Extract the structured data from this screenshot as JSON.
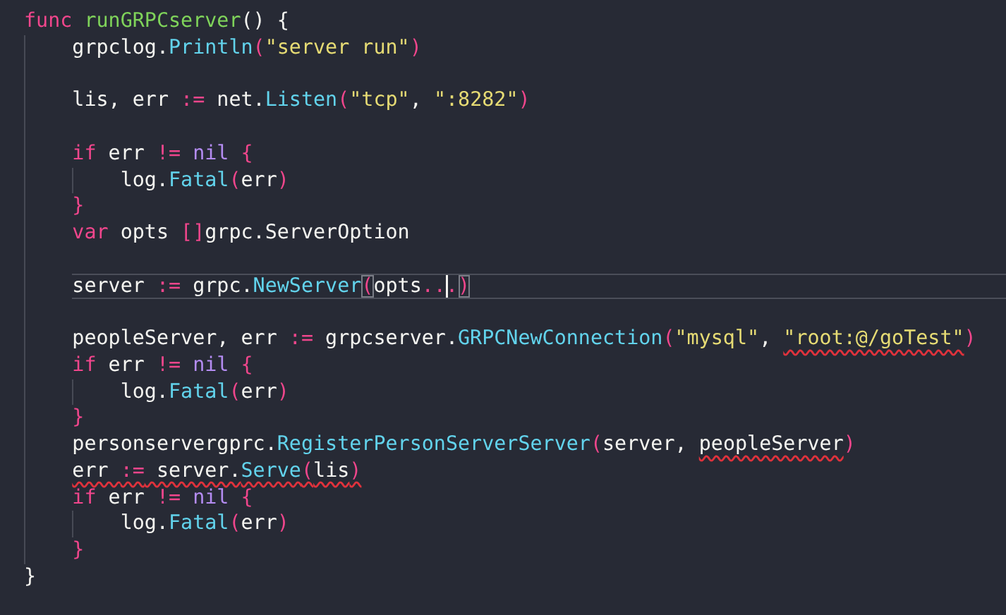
{
  "editor": {
    "lines": [
      {
        "current": false,
        "tokens": [
          {
            "kind": "keyword",
            "text": "func "
          },
          {
            "kind": "defname",
            "text": "runGRPCserver"
          },
          {
            "kind": "plain",
            "text": "() {"
          }
        ],
        "children": [
          {
            "current": false,
            "tokens": [
              {
                "kind": "plain",
                "text": "grpclog."
              },
              {
                "kind": "function",
                "text": "Println"
              },
              {
                "kind": "paren",
                "text": "("
              },
              {
                "kind": "string",
                "text": "\"server run\""
              },
              {
                "kind": "paren",
                "text": ")"
              }
            ]
          },
          {
            "current": false
          },
          {
            "current": false,
            "tokens": [
              {
                "kind": "plain",
                "text": "lis, err "
              },
              {
                "kind": "operator",
                "text": ":="
              },
              {
                "kind": "plain",
                "text": " net."
              },
              {
                "kind": "function",
                "text": "Listen"
              },
              {
                "kind": "paren",
                "text": "("
              },
              {
                "kind": "string",
                "text": "\"tcp\""
              },
              {
                "kind": "plain",
                "text": ", "
              },
              {
                "kind": "string",
                "text": "\":8282\""
              },
              {
                "kind": "paren",
                "text": ")"
              }
            ]
          },
          {
            "current": false
          },
          {
            "current": false,
            "tokens": [
              {
                "kind": "keyword",
                "text": "if"
              },
              {
                "kind": "plain",
                "text": " err "
              },
              {
                "kind": "operator",
                "text": "!="
              },
              {
                "kind": "constant",
                "text": " nil "
              },
              {
                "kind": "paren",
                "text": "{"
              }
            ],
            "children": [
              {
                "current": false,
                "tokens": [
                  {
                    "kind": "plain",
                    "text": "log."
                  },
                  {
                    "kind": "function",
                    "text": "Fatal"
                  },
                  {
                    "kind": "paren",
                    "text": "("
                  },
                  {
                    "kind": "plain",
                    "text": "err"
                  },
                  {
                    "kind": "paren",
                    "text": ")"
                  }
                ]
              }
            ]
          },
          {
            "current": false,
            "tokens": [
              {
                "kind": "paren",
                "text": "}"
              }
            ]
          },
          {
            "current": false,
            "tokens": [
              {
                "kind": "keyword",
                "text": "var"
              },
              {
                "kind": "plain",
                "text": " opts "
              },
              {
                "kind": "operator",
                "text": "[]"
              },
              {
                "kind": "plain",
                "text": "grpc.ServerOption"
              }
            ]
          },
          {
            "current": false
          },
          {
            "current": true,
            "tokens": [
              {
                "kind": "plain",
                "text": "server "
              },
              {
                "kind": "operator",
                "text": ":="
              },
              {
                "kind": "plain",
                "text": " grpc."
              },
              {
                "kind": "function",
                "text": "NewServer"
              },
              {
                "kind": "paren",
                "text": "(",
                "matched": true
              },
              {
                "kind": "plain",
                "text": "opts"
              },
              {
                "kind": "operator",
                "text": "..",
                "caret": true
              },
              {
                "kind": "operator",
                "text": "."
              },
              {
                "kind": "paren",
                "text": ")",
                "matched": true
              }
            ]
          },
          {
            "current": false
          },
          {
            "current": false,
            "tokens": [
              {
                "kind": "plain",
                "text": "peopleServer, err "
              },
              {
                "kind": "operator",
                "text": ":="
              },
              {
                "kind": "plain",
                "text": " grpcserver."
              },
              {
                "kind": "function",
                "text": "GRPCNewConnection"
              },
              {
                "kind": "paren",
                "text": "("
              },
              {
                "kind": "string",
                "text": "\"mysql\""
              },
              {
                "kind": "plain",
                "text": ", "
              },
              {
                "kind": "string",
                "text": "\"root:@/goTest\"",
                "error": true
              },
              {
                "kind": "paren",
                "text": ")"
              }
            ]
          },
          {
            "current": false,
            "tokens": [
              {
                "kind": "keyword",
                "text": "if"
              },
              {
                "kind": "plain",
                "text": " err "
              },
              {
                "kind": "operator",
                "text": "!="
              },
              {
                "kind": "constant",
                "text": " nil "
              },
              {
                "kind": "paren",
                "text": "{"
              }
            ],
            "children": [
              {
                "current": false,
                "tokens": [
                  {
                    "kind": "plain",
                    "text": "log."
                  },
                  {
                    "kind": "function",
                    "text": "Fatal"
                  },
                  {
                    "kind": "paren",
                    "text": "("
                  },
                  {
                    "kind": "plain",
                    "text": "err"
                  },
                  {
                    "kind": "paren",
                    "text": ")"
                  }
                ]
              }
            ]
          },
          {
            "current": false,
            "tokens": [
              {
                "kind": "paren",
                "text": "}"
              }
            ]
          },
          {
            "current": false,
            "tokens": [
              {
                "kind": "plain",
                "text": "personservergprc."
              },
              {
                "kind": "function",
                "text": "RegisterPersonServerServer"
              },
              {
                "kind": "paren",
                "text": "("
              },
              {
                "kind": "plain",
                "text": "server, "
              },
              {
                "kind": "plain",
                "text": "peopleServer",
                "error": true
              },
              {
                "kind": "paren",
                "text": ")"
              }
            ]
          },
          {
            "current": false,
            "tokens": [
              {
                "kind": "plain",
                "text": "err ",
                "error": true
              },
              {
                "kind": "operator",
                "text": ":=",
                "error": true
              },
              {
                "kind": "plain",
                "text": " server.",
                "error": true
              },
              {
                "kind": "function",
                "text": "Serve",
                "error": true
              },
              {
                "kind": "paren",
                "text": "(",
                "error": true
              },
              {
                "kind": "plain",
                "text": "lis",
                "error": true
              },
              {
                "kind": "paren",
                "text": ")",
                "error": true
              }
            ]
          },
          {
            "current": false,
            "tokens": [
              {
                "kind": "keyword",
                "text": "if"
              },
              {
                "kind": "plain",
                "text": " err "
              },
              {
                "kind": "operator",
                "text": "!="
              },
              {
                "kind": "constant",
                "text": " nil "
              },
              {
                "kind": "paren",
                "text": "{"
              }
            ],
            "children": [
              {
                "current": false,
                "tokens": [
                  {
                    "kind": "plain",
                    "text": "log."
                  },
                  {
                    "kind": "function",
                    "text": "Fatal"
                  },
                  {
                    "kind": "paren",
                    "text": "("
                  },
                  {
                    "kind": "plain",
                    "text": "err"
                  },
                  {
                    "kind": "paren",
                    "text": ")"
                  }
                ]
              }
            ]
          },
          {
            "current": false,
            "tokens": [
              {
                "kind": "paren",
                "text": "}"
              }
            ]
          }
        ]
      },
      {
        "current": false,
        "tokens": [
          {
            "kind": "plain",
            "text": "}"
          }
        ]
      }
    ]
  }
}
